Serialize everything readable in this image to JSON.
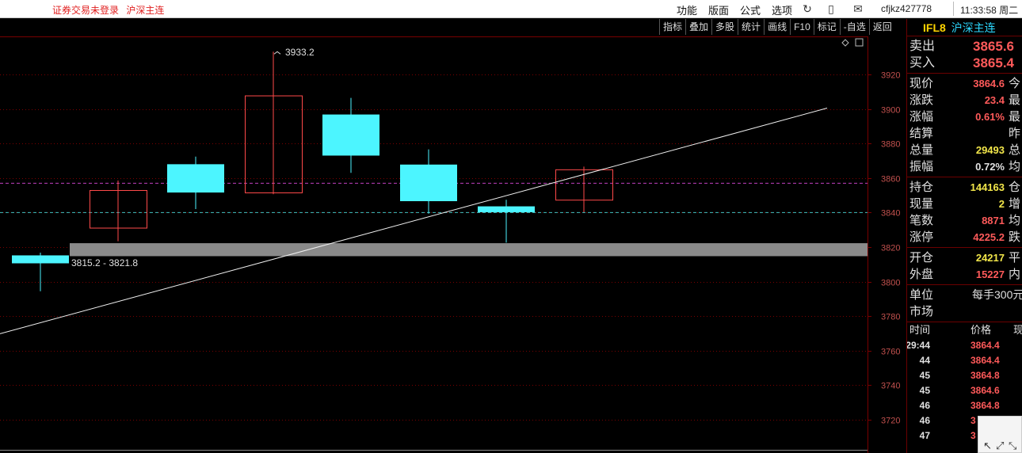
{
  "topbar": {
    "login_status": "证券交易未登录",
    "market_link": "沪深主连",
    "menu": [
      "功能",
      "版面",
      "公式",
      "选项"
    ],
    "icons": [
      "refresh-icon",
      "phone-icon",
      "mail-icon"
    ],
    "user": "cfjkz427778",
    "clock": "11:33:58 周二"
  },
  "toolbar": [
    "指标",
    "叠加",
    "多股",
    "统计",
    "画线",
    "F10",
    "标记",
    "-自选",
    "返回"
  ],
  "chart": {
    "y_ticks": [
      3920,
      3900,
      3880,
      3860,
      3840,
      3820,
      3800,
      3780,
      3760,
      3740,
      3720
    ],
    "candles": [
      {
        "open": 3815.2,
        "close": 3810.6,
        "high": 3816.8,
        "low": 3794.4
      },
      {
        "open": 3831.0,
        "close": 3852.8,
        "high": 3858.6,
        "low": 3823.4
      },
      {
        "open": 3868.0,
        "close": 3851.6,
        "high": 3872.4,
        "low": 3842.0
      },
      {
        "open": 3851.4,
        "close": 3907.6,
        "high": 3933.2,
        "low": 3850.6
      },
      {
        "open": 3896.8,
        "close": 3873.0,
        "high": 3906.4,
        "low": 3863.0
      },
      {
        "open": 3867.8,
        "close": 3846.6,
        "high": 3876.6,
        "low": 3839.4
      },
      {
        "open": 3843.6,
        "close": 3840.2,
        "high": 3847.4,
        "low": 3822.6
      },
      {
        "open": 3847.2,
        "close": 3864.8,
        "high": 3866.6,
        "low": 3840.2
      }
    ],
    "high_label": "3933.2",
    "zone_label": "3815.2 - 3821.8",
    "zone": [
      3815.2,
      3821.8
    ],
    "dash_levels": [
      3857,
      3840
    ],
    "trendline": [
      3769.8,
      3900.5
    ],
    "colors": {
      "up": "#ff4a4a",
      "down": "#4cf5ff",
      "zone": "#8a8a8a",
      "grid": "#7a0000"
    }
  },
  "panel": {
    "code": "IFL8",
    "name": "沪深主连",
    "sell_label": "卖出",
    "sell_price": "3865.6",
    "buy_label": "买入",
    "buy_price": "3865.4",
    "group1": [
      {
        "label": "现价",
        "value": "3864.6",
        "color": "red",
        "label2": "今"
      },
      {
        "label": "涨跌",
        "value": "23.4",
        "color": "red",
        "label2": "最"
      },
      {
        "label": "涨幅",
        "value": "0.61%",
        "color": "red",
        "label2": "最"
      },
      {
        "label": "结算",
        "value": "",
        "color": "wht",
        "label2": "昨"
      },
      {
        "label": "总量",
        "value": "29493",
        "color": "yel",
        "label2": "总"
      },
      {
        "label": "振幅",
        "value": "0.72%",
        "color": "wht",
        "label2": "均"
      }
    ],
    "group2": [
      {
        "label": "持仓",
        "value": "144163",
        "color": "yel",
        "label2": "仓"
      },
      {
        "label": "现量",
        "value": "2",
        "color": "yel",
        "label2": "增"
      },
      {
        "label": "笔数",
        "value": "8871",
        "color": "red",
        "label2": "均"
      },
      {
        "label": "涨停",
        "value": "4225.2",
        "color": "red",
        "label2": "跌"
      }
    ],
    "group3": [
      {
        "label": "开仓",
        "value": "24217",
        "color": "yel",
        "label2": "平"
      },
      {
        "label": "外盘",
        "value": "15227",
        "color": "red",
        "label2": "内"
      }
    ],
    "unit_label": "单位",
    "unit_value": "每手300元",
    "market_label": "市场",
    "tick_headers": [
      "时间",
      "价格",
      "现"
    ],
    "ticks": [
      {
        "time": "11:29:44",
        "price": "3864.4"
      },
      {
        "time": "44",
        "price": "3864.4"
      },
      {
        "time": "45",
        "price": "3864.8"
      },
      {
        "time": "45",
        "price": "3864.6"
      },
      {
        "time": "46",
        "price": "3864.8"
      },
      {
        "time": "46",
        "price": "3"
      },
      {
        "time": "47",
        "price": "3"
      }
    ]
  }
}
